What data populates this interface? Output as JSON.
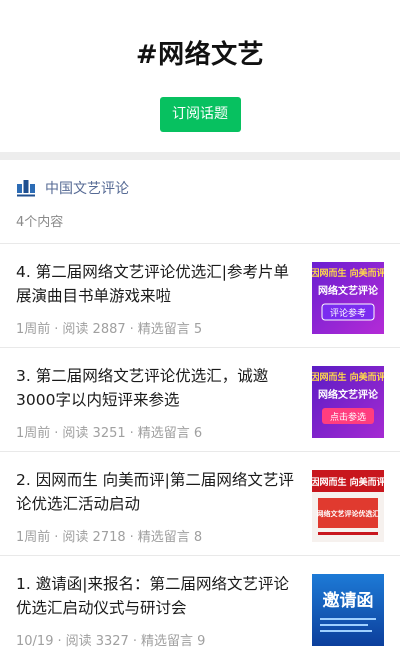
{
  "topic": {
    "title": "#网络文艺",
    "subscribe_label": "订阅话题"
  },
  "account": {
    "name": "中国文艺评论",
    "count": "4个内容"
  },
  "articles": [
    {
      "title": "4. 第二届网络文艺评论优选汇|参考片单展演曲目书单游戏来啦",
      "time": "1周前",
      "reads": "阅读 2887",
      "comments": "精选留言 5",
      "thumb": {
        "line1": "因网而生 向美而评",
        "line2": "网络文艺评论",
        "line3": "评论参考"
      }
    },
    {
      "title": "3. 第二届网络文艺评论优选汇，诚邀3000字以内短评来参选",
      "time": "1周前",
      "reads": "阅读 3251",
      "comments": "精选留言 6",
      "thumb": {
        "line1": "因网而生 向美而评",
        "line2": "网络文艺评论",
        "line3": "点击参选"
      }
    },
    {
      "title": "2. 因网而生 向美而评|第二届网络文艺评论优选汇活动启动",
      "time": "1周前",
      "reads": "阅读 2718",
      "comments": "精选留言 8",
      "thumb": {
        "line1": "因网而生 向美而评",
        "line2": "网络文艺评论优选汇"
      }
    },
    {
      "title": "1. 邀请函|来报名：第二届网络文艺评论优选汇启动仪式与研讨会",
      "time": "10/19",
      "reads": "阅读 3327",
      "comments": "精选留言 9",
      "thumb": {
        "line1": "邀请函"
      }
    }
  ],
  "colors": {
    "accent": "#07c160",
    "link": "#576b95",
    "meta": "#a0a0a0"
  }
}
